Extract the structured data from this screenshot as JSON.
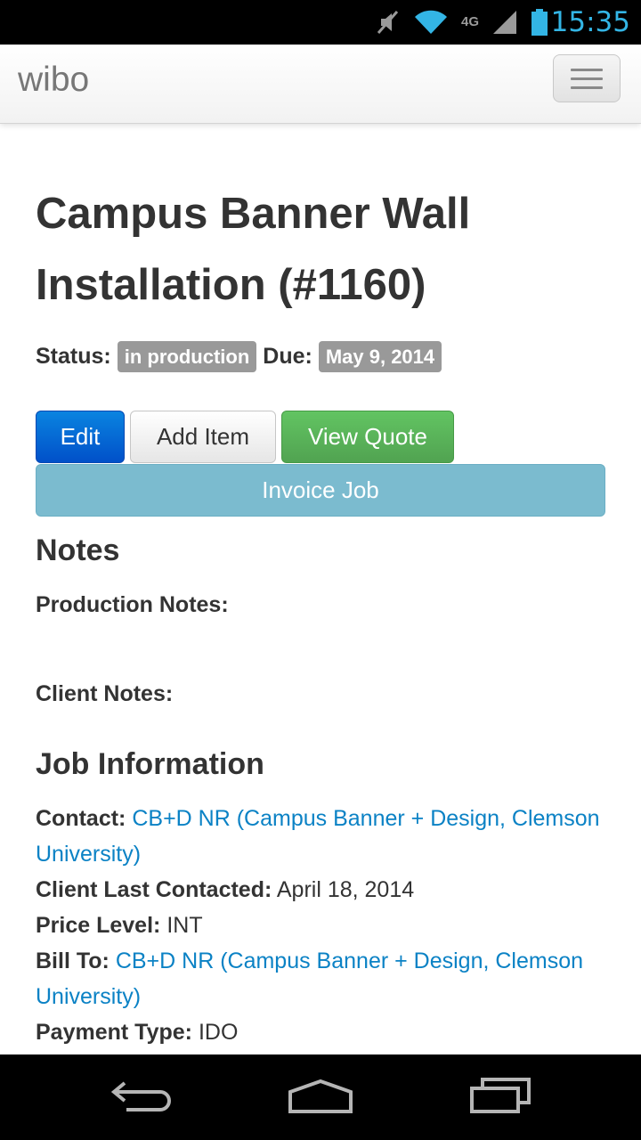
{
  "statusbar": {
    "time": "15:35",
    "network": "4G"
  },
  "navbar": {
    "brand": "wibo"
  },
  "job": {
    "title": "Campus Banner Wall Installation (#1160)",
    "status_label": "Status:",
    "status": "in production",
    "due_label": "Due:",
    "due": "May 9, 2014"
  },
  "buttons": {
    "edit": "Edit",
    "add_item": "Add Item",
    "view_quote": "View Quote",
    "invoice_job": "Invoice Job"
  },
  "notes": {
    "heading": "Notes",
    "production_label": "Production Notes:",
    "client_label": "Client Notes:"
  },
  "job_info": {
    "heading": "Job Information",
    "contact_label": "Contact:",
    "contact_value": "CB+D NR (Campus Banner + Design, Clemson University)",
    "last_contacted_label": "Client Last Contacted:",
    "last_contacted_value": "April 18, 2014",
    "price_level_label": "Price Level:",
    "price_level_value": "INT",
    "bill_to_label": "Bill To:",
    "bill_to_value": "CB+D NR (Campus Banner + Design, Clemson University)",
    "payment_type_label": "Payment Type:",
    "payment_type_value": "IDO"
  },
  "colors": {
    "primary": "#0150c9",
    "success": "#51a351",
    "info": "#7bbbcf",
    "link": "#0b82c5",
    "label": "#999999",
    "statusbar_accent": "#33b5e5"
  }
}
